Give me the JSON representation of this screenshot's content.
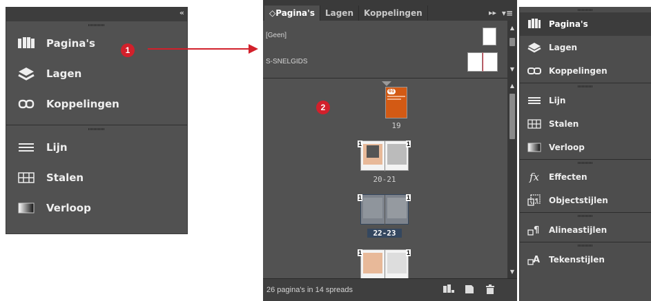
{
  "left_panel": {
    "collapse_icon": "«",
    "items": [
      {
        "label": "Pagina's",
        "icon": "pages-icon"
      },
      {
        "label": "Lagen",
        "icon": "layers-icon"
      },
      {
        "label": "Koppelingen",
        "icon": "links-icon"
      },
      {
        "label": "Lijn",
        "icon": "stroke-icon"
      },
      {
        "label": "Stalen",
        "icon": "swatches-icon"
      },
      {
        "label": "Verloop",
        "icon": "gradient-icon"
      }
    ]
  },
  "markers": {
    "one": "1",
    "two": "2"
  },
  "pages_panel": {
    "tabs": [
      {
        "label": "◇Pagina's",
        "active": true
      },
      {
        "label": "Lagen",
        "active": false
      },
      {
        "label": "Koppelingen",
        "active": false
      }
    ],
    "menu_icon": "▸▸",
    "list_icon": "▾≡",
    "masters": [
      {
        "label": "[Geen]"
      },
      {
        "label": "S-SNELGIDS"
      }
    ],
    "spreads": [
      {
        "label": "19",
        "selected": false
      },
      {
        "label": "20-21",
        "selected": false,
        "page_markers": [
          "1",
          "1"
        ]
      },
      {
        "label": "22-23",
        "selected": true,
        "page_markers": [
          "1",
          "1"
        ]
      },
      {
        "label": "",
        "selected": false,
        "page_markers": [
          "1",
          "1"
        ]
      }
    ],
    "cover_badge": "01",
    "status_text": "26 pagina's in 14 spreads"
  },
  "right_panel": {
    "items": [
      {
        "label": "Pagina's",
        "icon": "pages-icon",
        "active": true
      },
      {
        "label": "Lagen",
        "icon": "layers-icon"
      },
      {
        "label": "Koppelingen",
        "icon": "links-icon"
      },
      {
        "label": "Lijn",
        "icon": "stroke-icon"
      },
      {
        "label": "Stalen",
        "icon": "swatches-icon"
      },
      {
        "label": "Verloop",
        "icon": "gradient-icon"
      },
      {
        "label": "Effecten",
        "icon": "effects-icon"
      },
      {
        "label": "Objectstijlen",
        "icon": "object-styles-icon"
      },
      {
        "label": "Alineastijlen",
        "icon": "paragraph-styles-icon"
      },
      {
        "label": "Tekenstijlen",
        "icon": "character-styles-icon"
      }
    ]
  },
  "colors": {
    "accent_marker": "#d2202b",
    "arrow": "#d2202b",
    "cover_page": "#d35a14",
    "selection": "#34475f"
  }
}
